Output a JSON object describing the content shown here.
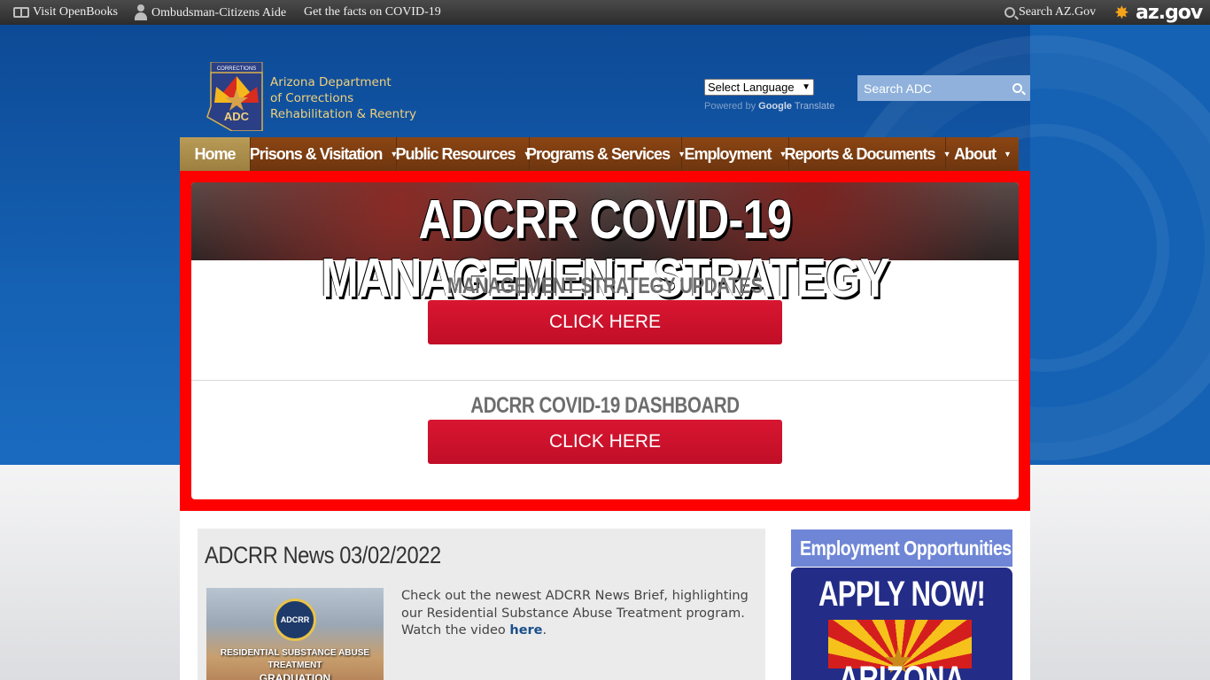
{
  "topbar": {
    "openbooks": "Visit OpenBooks",
    "ombudsman": "Ombudsman-Citizens Aide",
    "covid_facts": "Get the facts on COVID-19",
    "search_azgov": "Search AZ.Gov",
    "azgov_logo": "az.gov"
  },
  "header": {
    "badge_top": "CORRECTIONS",
    "badge_bottom": "ADC",
    "org_line1": "Arizona Department",
    "org_line2": "of Corrections",
    "org_line3": "Rehabilitation & Reentry",
    "language_select": "Select Language",
    "powered_by": "Powered by",
    "powered_google": "Google",
    "powered_translate": "Translate",
    "search_placeholder": "Search ADC"
  },
  "nav": {
    "items": [
      {
        "label": "Home"
      },
      {
        "label": "Prisons & Visitation"
      },
      {
        "label": "Public Resources"
      },
      {
        "label": "Programs & Services"
      },
      {
        "label": "Employment"
      },
      {
        "label": "Reports & Documents"
      },
      {
        "label": "About"
      }
    ]
  },
  "covid": {
    "banner_title": "ADCRR COVID-19 MANAGEMENT STRATEGY",
    "section1_title": "MANAGEMENT STRATEGY UPDATES",
    "section1_button": "CLICK HERE",
    "section2_title": "ADCRR COVID-19 DASHBOARD",
    "section2_button": "CLICK HERE"
  },
  "news": {
    "title": "ADCRR News 03/02/2022",
    "image_seal": "ADCRR",
    "image_caption_line1": "RESIDENTIAL SUBSTANCE ABUSE TREATMENT",
    "image_caption_line2": "GRADUATION",
    "body_line1": "Check out the newest ADCRR News Brief, highlighting our Residential Substance Abuse Treatment program.",
    "body_line2_prefix": "Watch the video ",
    "body_link": "here",
    "body_line2_suffix": "."
  },
  "employment": {
    "heading": "Employment Opportunities",
    "apply": "APPLY NOW!",
    "state": "ARIZONA"
  },
  "colors": {
    "nav_brown": "#8b4513",
    "home_gold": "#b99b57",
    "covid_red": "#ff0000",
    "button_red": "#c10e27",
    "header_gold_text": "#f1d07a",
    "employment_blue": "#232c87"
  }
}
